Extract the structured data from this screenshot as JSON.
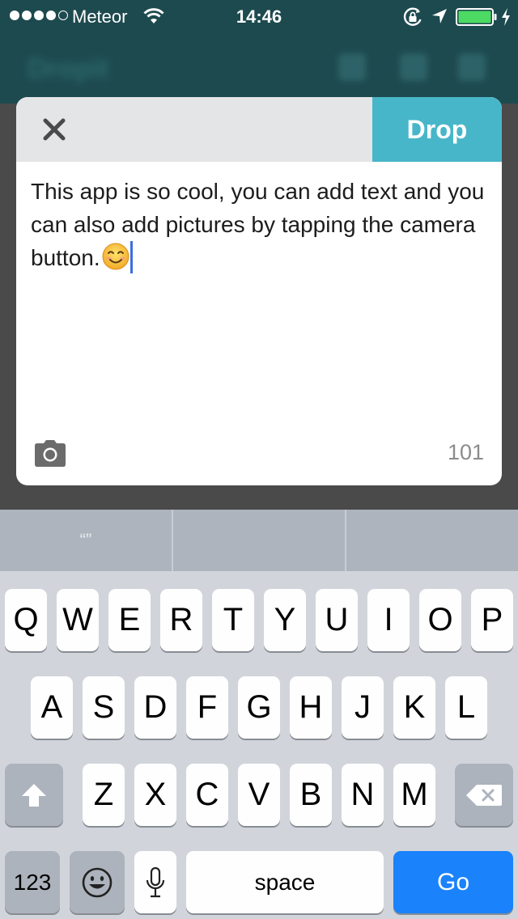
{
  "status_bar": {
    "carrier": "Meteor",
    "time": "14:46"
  },
  "background_app": {
    "title": "Dropit"
  },
  "compose": {
    "drop_label": "Drop",
    "message_text": "This app is so cool, you can add text and you can also add pictures by tapping the camera button.",
    "char_count": "101"
  },
  "keyboard": {
    "suggestions": [
      "“”",
      "",
      ""
    ],
    "row1": [
      "Q",
      "W",
      "E",
      "R",
      "T",
      "Y",
      "U",
      "I",
      "O",
      "P"
    ],
    "row2": [
      "A",
      "S",
      "D",
      "F",
      "G",
      "H",
      "J",
      "K",
      "L"
    ],
    "row3": [
      "Z",
      "X",
      "C",
      "V",
      "B",
      "N",
      "M"
    ],
    "numbers_label": "123",
    "space_label": "space",
    "go_label": "Go"
  },
  "colors": {
    "accent": "#48b6c9",
    "go_key": "#1a82fb",
    "nav_bar": "#1d4a4f"
  }
}
